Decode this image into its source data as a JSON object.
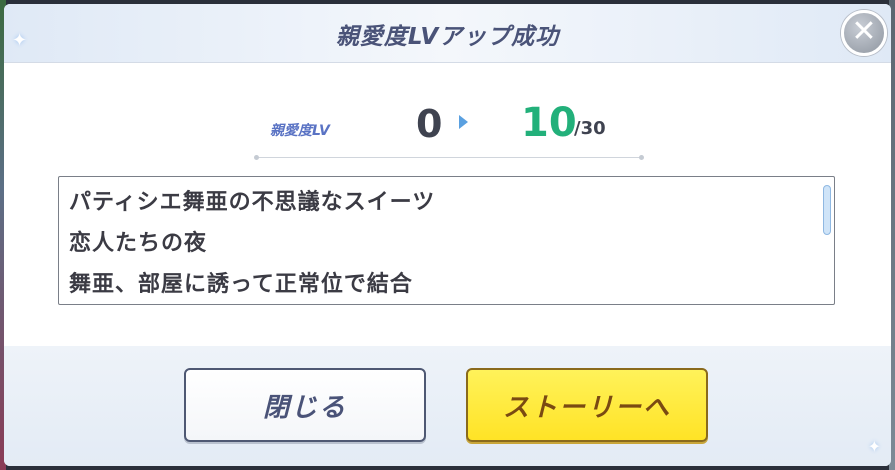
{
  "dialog": {
    "title": "親愛度LVアップ成功",
    "close_icon": "close-icon"
  },
  "affection": {
    "label": "親愛度LV",
    "from": "0",
    "to": "10",
    "max": "/30"
  },
  "stories": [
    "パティシエ舞亜の不思議なスイーツ",
    "恋人たちの夜",
    "舞亜、部屋に誘って正常位で結合"
  ],
  "buttons": {
    "close_label": "閉じる",
    "story_label": "ストーリーへ"
  },
  "colors": {
    "accent": "#4a5378",
    "level_new": "#22b07a",
    "story_button": "#ffe326"
  }
}
